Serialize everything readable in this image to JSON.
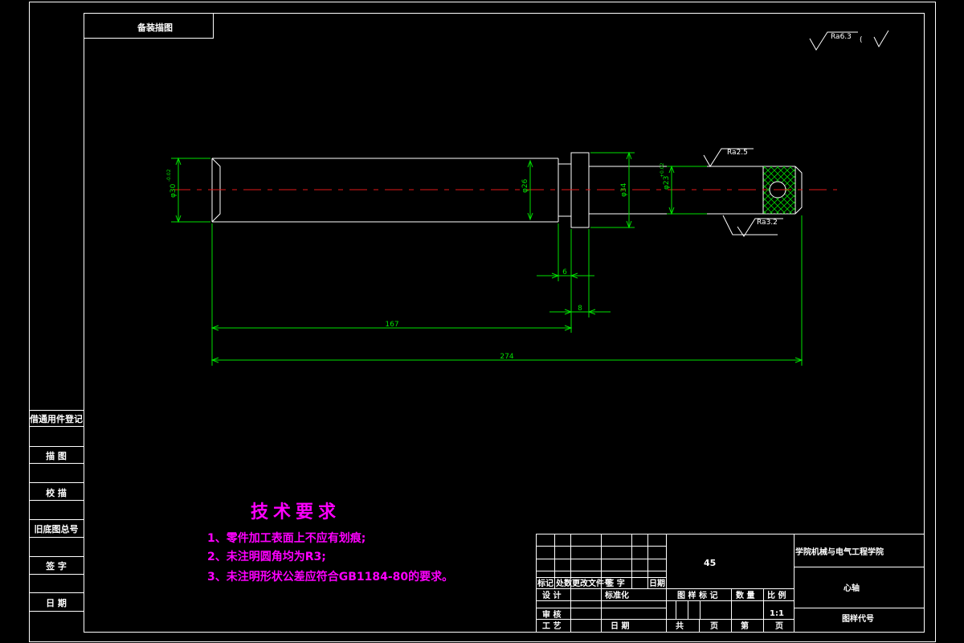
{
  "corner_label": "备装描图",
  "surface": {
    "top_right": "Ra6.3",
    "paren": "(",
    "r1": "Ra2.5",
    "r2": "Ra3.2"
  },
  "dims": {
    "d_left": "φ30",
    "d_left_tol": "-0.02",
    "d26": "φ26",
    "d34": "φ34",
    "d23": "φ23",
    "d23_tol": "+0.02",
    "l6": "6",
    "l8": "8",
    "l167": "167",
    "l274": "274"
  },
  "side_labels": [
    "借通用件登记",
    "描 图",
    "校 描",
    "旧底图总号",
    "签 字",
    "日 期"
  ],
  "tech": {
    "title": "技术要求",
    "items": [
      "1、零件加工表面上不应有划痕;",
      "2、未注明圆角均为R3;",
      "3、未注明形状公差应符合GB1184-80的要求。"
    ]
  },
  "title_block": {
    "material": "45",
    "school": "学院机械与电气工程学院",
    "part_name": "心轴",
    "drawing_no": "图样代号",
    "scale": "1:1",
    "h_biaoji": "标记",
    "h_chushu": "处数",
    "h_gengai": "更改文件号",
    "h_qianzi": "签 字",
    "h_riqi": "日期",
    "sheji": "设 计",
    "biaozhunhua": "标准化",
    "shenhe": "审 核",
    "gongyi": "工 艺",
    "riqi2": "日 期",
    "tuyang_biaoji": "图 样 标 记",
    "shuliang": "数 量",
    "bili": "比 例",
    "gong": "共",
    "ye1": "页",
    "di": "第",
    "ye2": "页"
  }
}
